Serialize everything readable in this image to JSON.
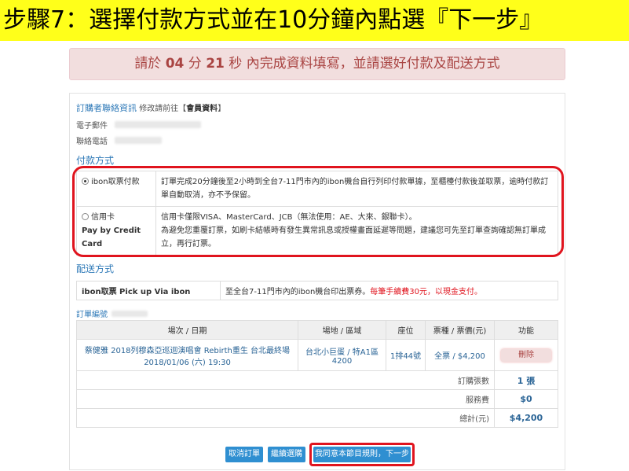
{
  "banner": {
    "text": "步驟7：選擇付款方式並在10分鐘內點選『下一步』"
  },
  "timer": {
    "prefix": "請於",
    "minutes": "04",
    "min_unit": "分",
    "seconds": "21",
    "sec_unit": "秒",
    "suffix": "內完成資料填寫，並請選好付款及配送方式"
  },
  "buyer": {
    "title": "訂購者聯絡資訊",
    "edit_hint": "修改請前往【",
    "member_link": "會員資料",
    "edit_hint_end": "】",
    "email_label": "電子郵件",
    "phone_label": "聯絡電話"
  },
  "payment": {
    "title": "付款方式",
    "options": [
      {
        "label": "ibon取票付款",
        "selected": true,
        "desc": "訂單完成20分鐘後至2小時到全台7-11門市內的ibon機台自行列印付款單據，至櫃檯付款後並取票，逾時付款訂單自動取消，亦不予保留。"
      },
      {
        "label": "信用卡",
        "sublabel": "Pay by Credit Card",
        "selected": false,
        "desc_line1": "信用卡僅限VISA、MasterCard、JCB（無法使用：AE、大來、銀聯卡）。",
        "desc_line2": "為避免您重覆訂票，如刷卡結帳時有發生異常訊息或授權畫面延遲等問題，建議您可先至訂單查詢確認無訂單成立，再行訂票。"
      }
    ]
  },
  "shipping": {
    "title": "配送方式",
    "method": "ibon取票 Pick up Via ibon",
    "desc": "至全台7-11門市內的ibon機台印出票券。",
    "fee_note": "每筆手續費30元，以現金支付。"
  },
  "order": {
    "title": "訂單編號",
    "headers": [
      "場次 / 日期",
      "場地 / 區域",
      "座位",
      "票種 / 票價(元)",
      "功能"
    ],
    "row": {
      "event_line1": "蔡健雅 2018列穆森亞巡迴演唱會 Rebirth重生 台北最終場",
      "event_line2": "2018/01/06 (六) 19:30",
      "venue": "台北小巨蛋 / 特A1區4200",
      "seat": "1排44號",
      "ticket": "全票 / $4,200",
      "action": "刪除"
    },
    "summary": [
      {
        "label": "訂購張數",
        "value": "1 張"
      },
      {
        "label": "服務費",
        "value": "$0"
      },
      {
        "label": "總計(元)",
        "value": "$4,200"
      }
    ]
  },
  "buttons": {
    "cancel": "取消訂單",
    "continue": "繼續選購",
    "next": "我同意本節目規則，下一步"
  },
  "colors": {
    "banner": "#ffff1a",
    "alert_bg": "#f2dede",
    "highlight": "#e0141e",
    "button": "#2f8fd1"
  }
}
